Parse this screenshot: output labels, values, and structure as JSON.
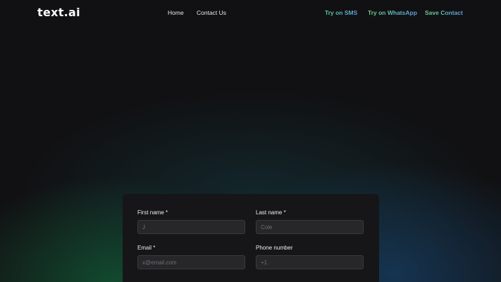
{
  "brand": {
    "logo_text": "text.ai"
  },
  "nav": {
    "home_label": "Home",
    "contact_label": "Contact Us"
  },
  "cta": {
    "sms_label": "Try on SMS",
    "whatsapp_label": "Try on WhatsApp",
    "save_label": "Save Contact"
  },
  "form": {
    "first_name": {
      "label": "First name *",
      "placeholder": "J"
    },
    "last_name": {
      "label": "Last name *",
      "placeholder": "Cole"
    },
    "email": {
      "label": "Email *",
      "placeholder": "x@email.com"
    },
    "phone": {
      "label": "Phone number",
      "placeholder": "+1"
    }
  },
  "colors": {
    "background": "#111113",
    "card": "#161618",
    "input": "#27272a",
    "accent_green": "#5fd18e",
    "accent_blue": "#5aa0e6"
  }
}
